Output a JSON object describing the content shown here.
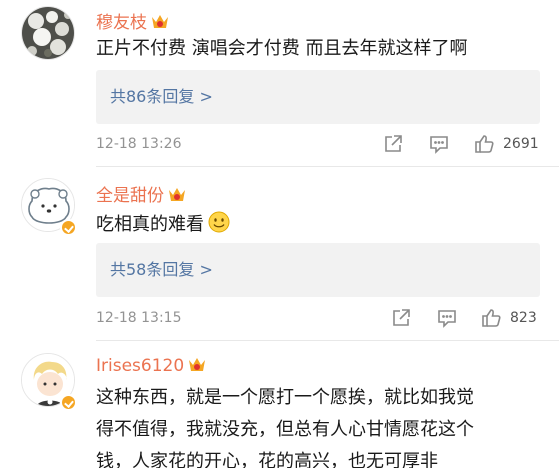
{
  "comments": [
    {
      "username": "穆友枝",
      "text": [
        "正片不付费 演唱会才付费 而且去年就这样了啊"
      ],
      "replies": "共86条回复 >",
      "time": "12-18 13:26",
      "likes": "2691"
    },
    {
      "username": "全是甜份",
      "text": [
        "吃相真的难看"
      ],
      "emoji": "smile-emoji",
      "replies": "共58条回复 >",
      "time": "12-18 13:15",
      "likes": "823"
    },
    {
      "username": "Irises6120",
      "text": [
        "这种东西，就是一个愿打一个愿挨，就比如我觉",
        "得不值得，我就没充，但总有人心甘情愿花这个",
        "钱，人家花的开心，花的高兴，也无可厚非"
      ]
    }
  ],
  "colors": {
    "username": "#eb7350",
    "replies": "#5476a3",
    "meta": "#939393",
    "vip": "#f5a623"
  },
  "icons": [
    "share-icon",
    "comment-icon",
    "like-icon",
    "vip-badge-icon",
    "member-badge-icon"
  ]
}
